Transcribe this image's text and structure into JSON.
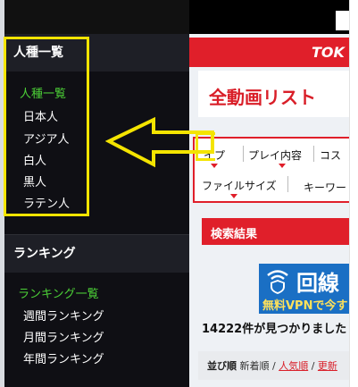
{
  "sidebar": {
    "section1_title": "人種一覧",
    "races": [
      {
        "label": "人種一覧",
        "active": true
      },
      {
        "label": "日本人"
      },
      {
        "label": "アジア人"
      },
      {
        "label": "白人"
      },
      {
        "label": "黒人"
      },
      {
        "label": "ラテン人"
      }
    ],
    "section2_title": "ランキング",
    "rankings": [
      {
        "label": "ランキング一覧",
        "active": true
      },
      {
        "label": "週間ランキング"
      },
      {
        "label": "月間ランキング"
      },
      {
        "label": "年間ランキング"
      }
    ]
  },
  "main": {
    "brand": "TOK",
    "page_title": "全動画リスト",
    "filters": {
      "type": "イプ",
      "play": "プレイ内容",
      "cos": "コス",
      "filesize": "ファイルサイズ",
      "keyword": "キーワー"
    },
    "results_title": "検索結果",
    "vpn": {
      "big": "回線",
      "small": "無料VPNで今す"
    },
    "count_text": "14222件が見つかりました",
    "sort": {
      "label": "並び順",
      "new": "新着順",
      "popular": "人気順",
      "updated": "更新"
    }
  },
  "colors": {
    "accent_red": "#e01f2a",
    "highlight_yellow": "#f4e400",
    "link_green": "#4cd137",
    "sidebar_bg": "#0f0f14"
  }
}
